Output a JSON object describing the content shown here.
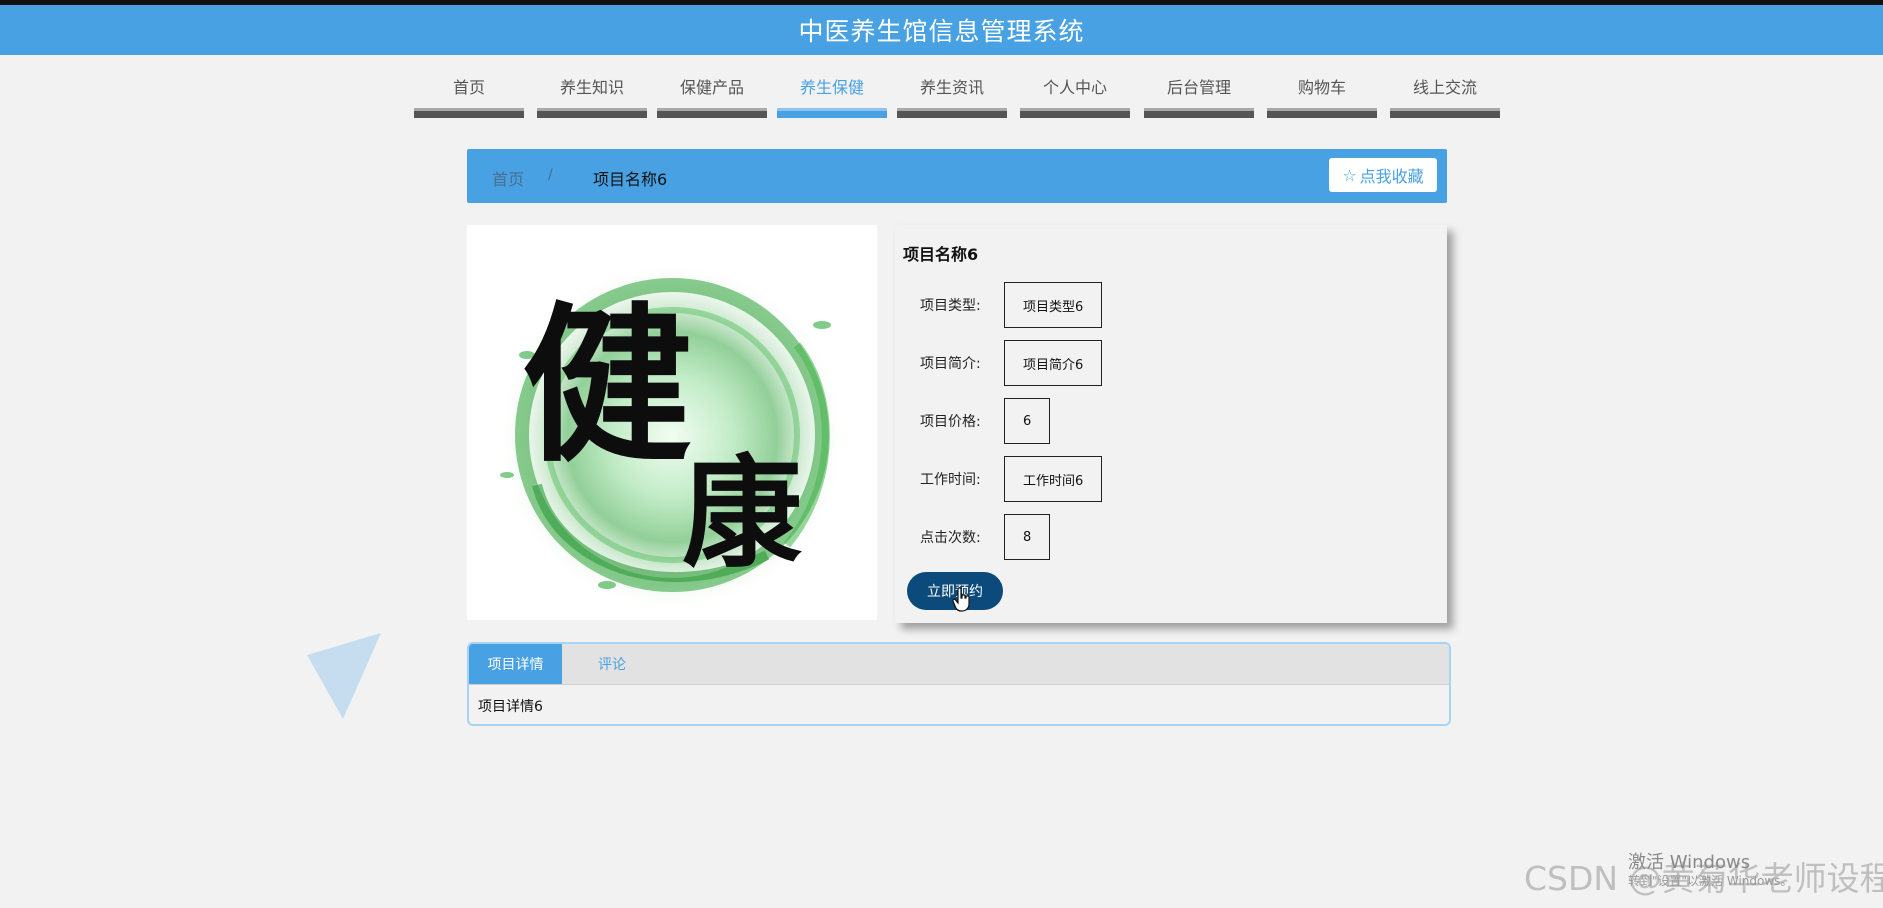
{
  "header": {
    "title": "中医养生馆信息管理系统"
  },
  "nav": {
    "items": [
      {
        "label": "首页",
        "active": false
      },
      {
        "label": "养生知识",
        "active": false
      },
      {
        "label": "保健产品",
        "active": false
      },
      {
        "label": "养生保健",
        "active": true
      },
      {
        "label": "养生资讯",
        "active": false
      },
      {
        "label": "个人中心",
        "active": false
      },
      {
        "label": "后台管理",
        "active": false
      },
      {
        "label": "购物车",
        "active": false
      },
      {
        "label": "线上交流",
        "active": false
      }
    ]
  },
  "breadcrumb": {
    "home": "首页",
    "separator": "/",
    "current": "项目名称6",
    "favorite_label": "点我收藏",
    "favorite_icon": "star-outline-icon"
  },
  "product": {
    "image_text": [
      "健",
      "康"
    ],
    "name": "项目名称6",
    "fields": [
      {
        "label": "项目类型:",
        "value": "项目类型6"
      },
      {
        "label": "项目简介:",
        "value": "项目简介6"
      },
      {
        "label": "项目价格:",
        "value": "6"
      },
      {
        "label": "工作时间:",
        "value": "工作时间6"
      },
      {
        "label": "点击次数:",
        "value": "8"
      }
    ],
    "book_label": "立即预约"
  },
  "tabs": {
    "items": [
      {
        "label": "项目详情",
        "active": true
      },
      {
        "label": "评论",
        "active": false
      }
    ],
    "content": "项目详情6"
  },
  "watermarks": {
    "activate": "激活 Windows",
    "activate_sub": "转到\"设置\"以激活 Windows。",
    "csdn": "CSDN @黄菊华老师设程序"
  },
  "colors": {
    "primary": "#48a1e2",
    "book_button": "#0b4a7a",
    "background": "#f2f2f2"
  }
}
